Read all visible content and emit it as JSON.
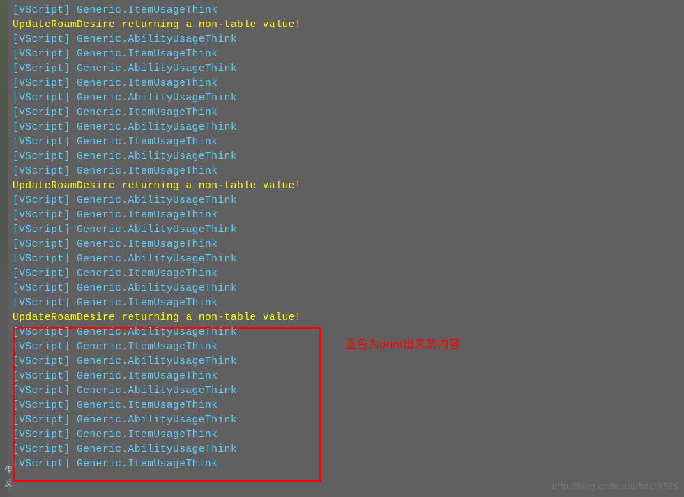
{
  "console": {
    "lines": [
      {
        "type": "script",
        "tag": "[VScript]",
        "msg": "Generic.ItemUsageThink"
      },
      {
        "type": "warning",
        "text": "UpdateRoamDesire returning a non-table value!"
      },
      {
        "type": "script",
        "tag": "[VScript]",
        "msg": "Generic.AbilityUsageThink"
      },
      {
        "type": "script",
        "tag": "[VScript]",
        "msg": "Generic.ItemUsageThink"
      },
      {
        "type": "script",
        "tag": "[VScript]",
        "msg": "Generic.AbilityUsageThink"
      },
      {
        "type": "script",
        "tag": "[VScript]",
        "msg": "Generic.ItemUsageThink"
      },
      {
        "type": "script",
        "tag": "[VScript]",
        "msg": "Generic.AbilityUsageThink"
      },
      {
        "type": "script",
        "tag": "[VScript]",
        "msg": "Generic.ItemUsageThink"
      },
      {
        "type": "script",
        "tag": "[VScript]",
        "msg": "Generic.AbilityUsageThink"
      },
      {
        "type": "script",
        "tag": "[VScript]",
        "msg": "Generic.ItemUsageThink"
      },
      {
        "type": "script",
        "tag": "[VScript]",
        "msg": "Generic.AbilityUsageThink"
      },
      {
        "type": "script",
        "tag": "[VScript]",
        "msg": "Generic.ItemUsageThink"
      },
      {
        "type": "warning",
        "text": "UpdateRoamDesire returning a non-table value!"
      },
      {
        "type": "script",
        "tag": "[VScript]",
        "msg": "Generic.AbilityUsageThink"
      },
      {
        "type": "script",
        "tag": "[VScript]",
        "msg": "Generic.ItemUsageThink"
      },
      {
        "type": "script",
        "tag": "[VScript]",
        "msg": "Generic.AbilityUsageThink"
      },
      {
        "type": "script",
        "tag": "[VScript]",
        "msg": "Generic.ItemUsageThink"
      },
      {
        "type": "script",
        "tag": "[VScript]",
        "msg": "Generic.AbilityUsageThink"
      },
      {
        "type": "script",
        "tag": "[VScript]",
        "msg": "Generic.ItemUsageThink"
      },
      {
        "type": "script",
        "tag": "[VScript]",
        "msg": "Generic.AbilityUsageThink"
      },
      {
        "type": "script",
        "tag": "[VScript]",
        "msg": "Generic.ItemUsageThink"
      },
      {
        "type": "warning",
        "text": "UpdateRoamDesire returning a non-table value!"
      },
      {
        "type": "script",
        "tag": "[VScript]",
        "msg": "Generic.AbilityUsageThink"
      },
      {
        "type": "script",
        "tag": "[VScript]",
        "msg": "Generic.ItemUsageThink"
      },
      {
        "type": "script",
        "tag": "[VScript]",
        "msg": "Generic.AbilityUsageThink"
      },
      {
        "type": "script",
        "tag": "[VScript]",
        "msg": "Generic.ItemUsageThink"
      },
      {
        "type": "script",
        "tag": "[VScript]",
        "msg": "Generic.AbilityUsageThink"
      },
      {
        "type": "script",
        "tag": "[VScript]",
        "msg": "Generic.ItemUsageThink"
      },
      {
        "type": "script",
        "tag": "[VScript]",
        "msg": "Generic.AbilityUsageThink"
      },
      {
        "type": "script",
        "tag": "[VScript]",
        "msg": "Generic.ItemUsageThink"
      },
      {
        "type": "script",
        "tag": "[VScript]",
        "msg": "Generic.AbilityUsageThink"
      },
      {
        "type": "script",
        "tag": "[VScript]",
        "msg": "Generic.ItemUsageThink"
      }
    ]
  },
  "annotation": {
    "text": "蓝色为print出来的内容"
  },
  "watermark": {
    "text": "http://blog.csdn.net/hai29785"
  },
  "bottom_chars": "传 反"
}
